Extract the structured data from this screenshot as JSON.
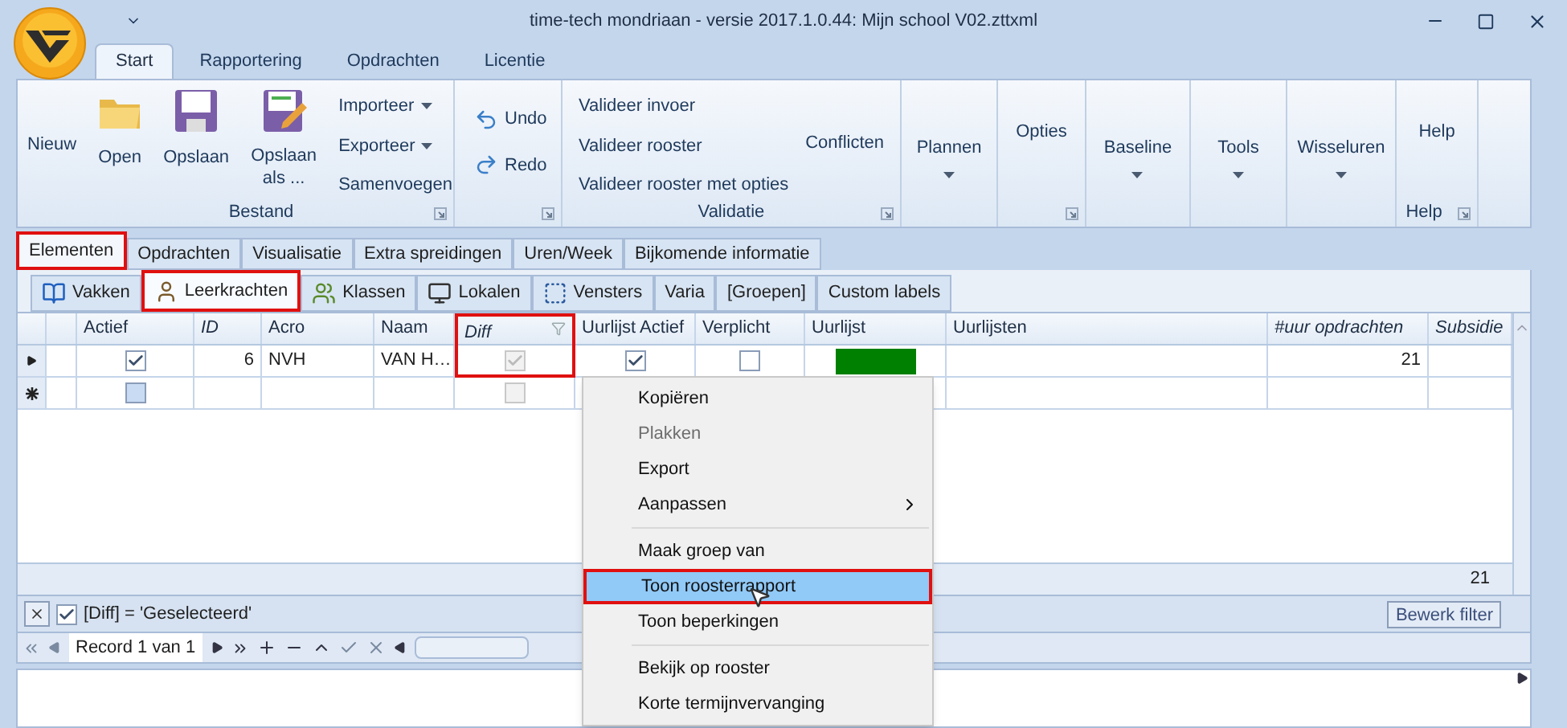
{
  "window": {
    "title": "time-tech mondriaan - versie 2017.1.0.44: Mijn school V02.zttxml"
  },
  "ribbon_tabs": [
    {
      "label": "Start",
      "selected": true
    },
    {
      "label": "Rapportering",
      "selected": false
    },
    {
      "label": "Opdrachten",
      "selected": false
    },
    {
      "label": "Licentie",
      "selected": false
    }
  ],
  "ribbon": {
    "bestand": {
      "label": "Bestand",
      "nieuw": "Nieuw",
      "open": "Open",
      "opslaan": "Opslaan",
      "opslaan_als": "Opslaan als ...",
      "menus": [
        {
          "label": "Importeer",
          "dropdown": true
        },
        {
          "label": "Exporteer",
          "dropdown": true
        },
        {
          "label": "Samenvoegen",
          "dropdown": false
        }
      ]
    },
    "history": {
      "undo": "Undo",
      "redo": "Redo"
    },
    "validatie": {
      "label": "Validatie",
      "items": [
        "Valideer invoer",
        "Valideer rooster",
        "Valideer rooster met opties"
      ],
      "conflicten": "Conflicten"
    },
    "buttons": [
      {
        "label": "Plannen",
        "dropdown": true,
        "launcher": false
      },
      {
        "label": "Opties",
        "dropdown": false,
        "launcher": true
      },
      {
        "label": "Baseline",
        "dropdown": true,
        "launcher": false
      },
      {
        "label": "Tools",
        "dropdown": true,
        "launcher": false
      },
      {
        "label": "Wisseluren",
        "dropdown": true,
        "launcher": false
      }
    ],
    "help": {
      "button": "Help",
      "label": "Help"
    }
  },
  "main_tabs": [
    {
      "label": "Elementen",
      "selected": true,
      "annotated": true
    },
    {
      "label": "Opdrachten",
      "selected": false,
      "annotated": false
    },
    {
      "label": "Visualisatie",
      "selected": false,
      "annotated": false
    },
    {
      "label": "Extra spreidingen",
      "selected": false,
      "annotated": false
    },
    {
      "label": "Uren/Week",
      "selected": false,
      "annotated": false
    },
    {
      "label": "Bijkomende informatie",
      "selected": false,
      "annotated": false
    }
  ],
  "element_tabs": [
    {
      "kind": "book",
      "label": "Vakken",
      "selected": false,
      "annotated": false
    },
    {
      "kind": "person",
      "label": "Leerkrachten",
      "selected": true,
      "annotated": true
    },
    {
      "kind": "group",
      "label": "Klassen",
      "selected": false,
      "annotated": false
    },
    {
      "kind": "screen",
      "label": "Lokalen",
      "selected": false,
      "annotated": false
    },
    {
      "kind": "frame",
      "label": "Vensters",
      "selected": false,
      "annotated": false
    },
    {
      "kind": "plain",
      "label": "Varia",
      "selected": false,
      "annotated": false
    },
    {
      "kind": "plain",
      "label": "[Groepen]",
      "selected": false,
      "annotated": false
    },
    {
      "kind": "plain",
      "label": "Custom labels",
      "selected": false,
      "annotated": false
    }
  ],
  "table": {
    "columns": [
      {
        "label": "Actief",
        "italic": false,
        "filter": false,
        "annotated": false
      },
      {
        "label": "ID",
        "italic": true,
        "filter": false,
        "annotated": false
      },
      {
        "label": "Acro",
        "italic": false,
        "filter": false,
        "annotated": false
      },
      {
        "label": "Naam",
        "italic": false,
        "filter": false,
        "annotated": false
      },
      {
        "label": "Diff",
        "italic": true,
        "filter": true,
        "annotated": true
      },
      {
        "label": "Uurlijst Actief",
        "italic": false,
        "filter": false,
        "annotated": false
      },
      {
        "label": "Verplicht",
        "italic": false,
        "filter": false,
        "annotated": false
      },
      {
        "label": "Uurlijst",
        "italic": false,
        "filter": false,
        "annotated": false
      },
      {
        "label": "Uurlijsten",
        "italic": false,
        "filter": false,
        "annotated": false
      },
      {
        "label": "#uur opdrachten",
        "italic": true,
        "filter": false,
        "annotated": false
      },
      {
        "label": "Subsidie",
        "italic": true,
        "filter": false,
        "annotated": false
      }
    ],
    "rows": [
      {
        "kind": "record",
        "cells": [
          {
            "kind": "check",
            "checked": true,
            "disabled": false
          },
          {
            "kind": "number",
            "text": "6"
          },
          {
            "kind": "text",
            "text": "NVH"
          },
          {
            "kind": "text",
            "text": "VAN H…"
          },
          {
            "kind": "check",
            "checked": true,
            "disabled": true
          },
          {
            "kind": "check",
            "checked": true,
            "disabled": false
          },
          {
            "kind": "check",
            "checked": false,
            "disabled": false
          },
          {
            "kind": "color",
            "color": "#008000"
          },
          {
            "kind": "empty"
          },
          {
            "kind": "number",
            "text": "21"
          },
          {
            "kind": "empty"
          }
        ]
      },
      {
        "kind": "new",
        "cells": [
          {
            "kind": "check",
            "checked": false,
            "disabled": false
          },
          {
            "kind": "empty"
          },
          {
            "kind": "empty"
          },
          {
            "kind": "empty"
          },
          {
            "kind": "check",
            "checked": false,
            "disabled": true
          },
          {
            "kind": "empty"
          },
          {
            "kind": "empty"
          },
          {
            "kind": "empty"
          },
          {
            "kind": "empty"
          },
          {
            "kind": "empty"
          },
          {
            "kind": "empty"
          }
        ]
      }
    ],
    "summary": {
      "total": "21"
    }
  },
  "filter_bar": {
    "enabled": true,
    "text": "[Diff] = 'Geselecteerd'",
    "edit_button": "Bewerk filter"
  },
  "navigator": {
    "record": "Record 1 van 1"
  },
  "context_menu": [
    {
      "kind": "item",
      "label": "Kopiëren",
      "disabled": false,
      "submenu": false,
      "selected": false,
      "annotated": false
    },
    {
      "kind": "item",
      "label": "Plakken",
      "disabled": true,
      "submenu": false,
      "selected": false,
      "annotated": false
    },
    {
      "kind": "item",
      "label": "Export",
      "disabled": false,
      "submenu": false,
      "selected": false,
      "annotated": false
    },
    {
      "kind": "item",
      "label": "Aanpassen",
      "disabled": false,
      "submenu": true,
      "selected": false,
      "annotated": false
    },
    {
      "kind": "separator"
    },
    {
      "kind": "item",
      "label": "Maak groep van",
      "disabled": false,
      "submenu": false,
      "selected": false,
      "annotated": false
    },
    {
      "kind": "item",
      "label": "Toon roosterrapport",
      "disabled": false,
      "submenu": false,
      "selected": true,
      "annotated": true
    },
    {
      "kind": "item",
      "label": "Toon beperkingen",
      "disabled": false,
      "submenu": false,
      "selected": false,
      "annotated": false
    },
    {
      "kind": "separator"
    },
    {
      "kind": "item",
      "label": "Bekijk op rooster",
      "disabled": false,
      "submenu": false,
      "selected": false,
      "annotated": false
    },
    {
      "kind": "item",
      "label": "Korte termijnvervanging",
      "disabled": false,
      "submenu": false,
      "selected": false,
      "annotated": false
    }
  ]
}
